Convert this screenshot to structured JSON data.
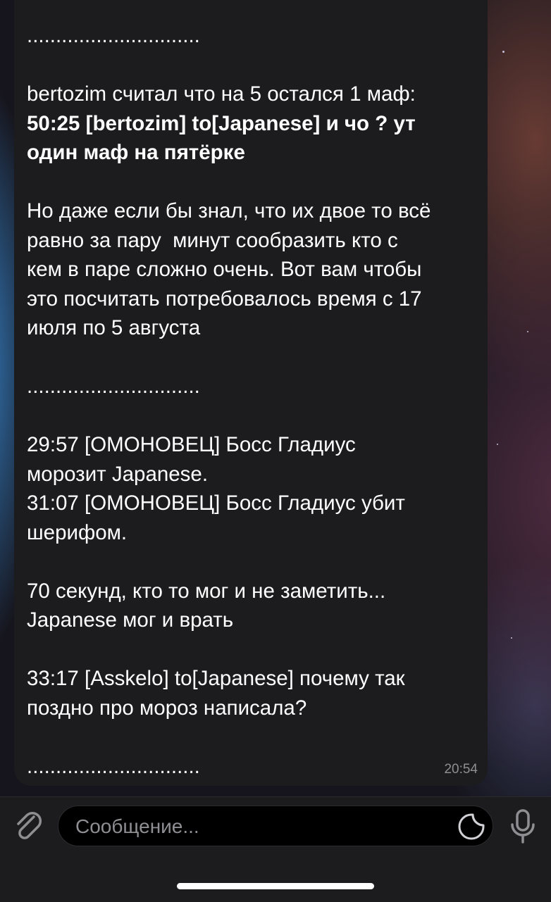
{
  "message": {
    "lines": [
      {
        "text": "..............................",
        "bold": false
      },
      {
        "text": "",
        "bold": false
      },
      {
        "text": "bertozim считал что на 5 остался 1 маф:",
        "bold": false
      },
      {
        "text": "50:25 [bertozim] to[Japanese] и чо ? ут",
        "bold": true
      },
      {
        "text": "один маф на пятёрке",
        "bold": true
      },
      {
        "text": "",
        "bold": false
      },
      {
        "text": "Но даже если бы знал, что их двое то всё",
        "bold": false
      },
      {
        "text": "равно за пару  минут сообразить кто с",
        "bold": false
      },
      {
        "text": "кем в паре сложно очень. Вот вам чтобы",
        "bold": false
      },
      {
        "text": "это посчитать потребовалось время с 17",
        "bold": false
      },
      {
        "text": "июля по 5 августа",
        "bold": false
      },
      {
        "text": "",
        "bold": false
      },
      {
        "text": "..............................",
        "bold": false
      },
      {
        "text": "",
        "bold": false
      },
      {
        "text": "29:57 [ОМОНОВЕЦ] Босс Гладиус",
        "bold": false
      },
      {
        "text": "морозит Japanese.",
        "bold": false
      },
      {
        "text": "31:07 [ОМОНОВЕЦ] Босс Гладиус убит",
        "bold": false
      },
      {
        "text": "шерифом.",
        "bold": false
      },
      {
        "text": "",
        "bold": false
      },
      {
        "text": "70 секунд, кто то мог и не заметить...",
        "bold": false
      },
      {
        "text": "Japanese мог и врать",
        "bold": false
      },
      {
        "text": "",
        "bold": false
      },
      {
        "text": "33:17 [Asskelo] to[Japanese] почему так",
        "bold": false
      },
      {
        "text": "поздно про мороз написала?",
        "bold": false
      },
      {
        "text": "",
        "bold": false
      },
      {
        "text": "..............................",
        "bold": false
      }
    ],
    "time": "20:54"
  },
  "composer": {
    "placeholder": "Сообщение...",
    "attach_icon": "paperclip-icon",
    "sticker_icon": "sticker-icon",
    "mic_icon": "microphone-icon"
  },
  "colors": {
    "bubble": "#1c1c1e",
    "text": "#ffffff",
    "meta": "#8e8e93"
  }
}
